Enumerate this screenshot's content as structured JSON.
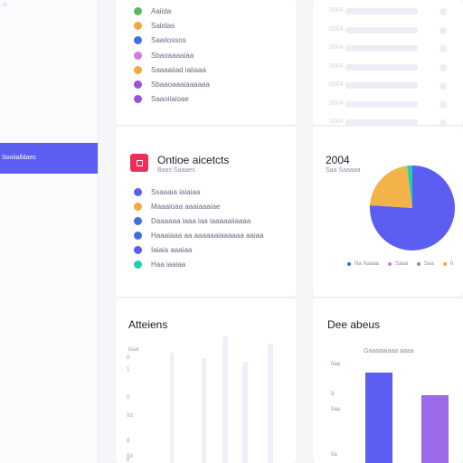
{
  "sidebar": {
    "top_mark": "☺",
    "active_item_label": "Sooiialldaes"
  },
  "top_legend": {
    "items": [
      {
        "label": "Aaiida",
        "color": "#5bb85c"
      },
      {
        "label": "Saiidas",
        "color": "#f2a83a"
      },
      {
        "label": "Saaiiossos",
        "color": "#3f6fe0"
      },
      {
        "label": "Sbaoaaaaiaa",
        "color": "#d57ad8"
      },
      {
        "label": "Saaaaiiad iaiiaaa",
        "color": "#f2a83a"
      },
      {
        "label": "Sbaaoaaaiaaaaaa",
        "color": "#9a52d6"
      },
      {
        "label": "Saaoiiaioae",
        "color": "#9a52d6"
      }
    ]
  },
  "faded_card": {
    "rows": [
      "0004",
      "0004",
      "0004",
      "0004",
      "0004",
      "0004",
      "0004"
    ]
  },
  "mid_card": {
    "title": "Ontioe aicetcts",
    "subtitle": "Baas Saaaes",
    "items": [
      {
        "label": "Ssaaaia iaiaiaa",
        "color": "#5b5ef0"
      },
      {
        "label": "Maaaioaa aaaiaaaiae",
        "color": "#f2a83a"
      },
      {
        "label": "Daaaaaa iaaa iaa iaaaaaiiaaaa",
        "color": "#3f6fe0"
      },
      {
        "label": "Haaaiaaa aa aaaaaaiaaaaaa aaiaa",
        "color": "#3f6fe0"
      },
      {
        "label": "Iaiaia aaaiaa",
        "color": "#5b5ef0"
      },
      {
        "label": "Haa iaaiaa",
        "color": "#1fcfb0"
      }
    ]
  },
  "pie_card": {
    "title": "2004",
    "subtitle": "Saa Saaaaa",
    "legend": [
      {
        "label": "Na Naaaa",
        "color": "#3f6fe0"
      },
      {
        "label": "Saaa",
        "color": "#d57ad8"
      },
      {
        "label": "Saa",
        "color": "#8a8ea6"
      },
      {
        "label": "0",
        "color": "#f2a83a"
      }
    ]
  },
  "activity_card": {
    "title": "Atteiens",
    "axis_top": "baat",
    "ticks": [
      "8",
      "1",
      "0",
      "0d",
      "8",
      "0d",
      "8"
    ]
  },
  "bars_card": {
    "title": "Dee abeus",
    "subtitle": "Gaaaaaiaaa aaaa",
    "yticks": [
      "0aa",
      "3",
      "0aa",
      "0a"
    ]
  },
  "chart_data": {
    "type": "pie",
    "title": "2004",
    "values": [
      76,
      22,
      2
    ],
    "colors": [
      "#5b5ef0",
      "#f2b448",
      "#1fcfb0"
    ]
  },
  "bar_chart_data": {
    "type": "bar",
    "values": [
      100,
      75
    ],
    "colors": [
      "#5b5ef0",
      "#9a6ae8"
    ]
  }
}
